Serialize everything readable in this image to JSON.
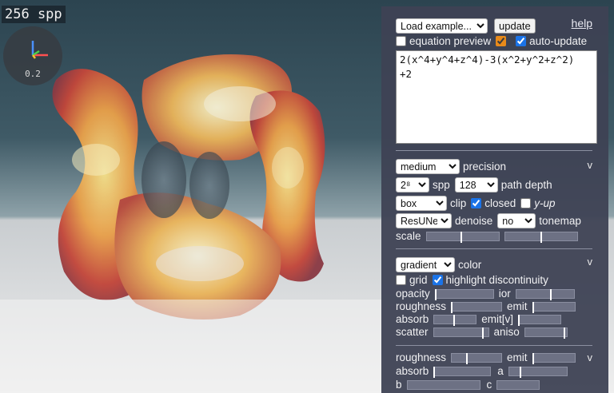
{
  "viewport": {
    "spp_label": "256 spp",
    "gizmo_value": "0.2"
  },
  "panel": {
    "example_select": {
      "value": "Load example..."
    },
    "update_label": "update",
    "help_label": "help",
    "equation_preview": {
      "label": "equation preview",
      "checked": false,
      "color_checked": true
    },
    "auto_update": {
      "label": "auto-update",
      "checked": true
    },
    "equation": "2(x^4+y^4+z^4)-3(x^2+y^2+z^2)\n+2",
    "render": {
      "precision_value": "medium",
      "precision_label": "precision",
      "spp_value": "2⁸",
      "spp_label": "spp",
      "path_depth_value": "128",
      "path_depth_label": "path depth",
      "clip_value": "box",
      "clip_label": "clip",
      "closed_label": "closed",
      "closed_checked": true,
      "yup_label": "y-up",
      "yup_checked": false,
      "denoise_value": "ResUNet",
      "denoise_label": "denoise",
      "tonemap_value": "no",
      "tonemap_label": "tonemap",
      "scale_label": "scale",
      "scale_a": 0.48,
      "scale_b": 0.5,
      "collapse_label": "v"
    },
    "material": {
      "color_value": "gradient",
      "color_label": "color",
      "grid_label": "grid",
      "grid_checked": false,
      "highlight_label": "highlight discontinuity",
      "highlight_checked": true,
      "opacity_label": "opacity",
      "opacity": 0.0,
      "ior_label": "ior",
      "ior": 0.6,
      "roughness_label": "roughness",
      "roughness": 0.0,
      "emit_label": "emit",
      "emit": 0.0,
      "absorb_label": "absorb",
      "absorb": 0.48,
      "emitv_label": "emit[v]",
      "emitv": 0.0,
      "scatter_label": "scatter",
      "scatter": 0.9,
      "aniso_label": "aniso",
      "aniso": 0.95,
      "collapse_label": "v"
    },
    "floor": {
      "roughness_label": "roughness",
      "roughness": 0.3,
      "emit_label": "emit",
      "emit": 0.0,
      "absorb_label": "absorb",
      "absorb": 0.0,
      "a_label": "a",
      "a": 0.2,
      "b_label": "b",
      "c_label": "c",
      "collapse_label": "v"
    }
  }
}
